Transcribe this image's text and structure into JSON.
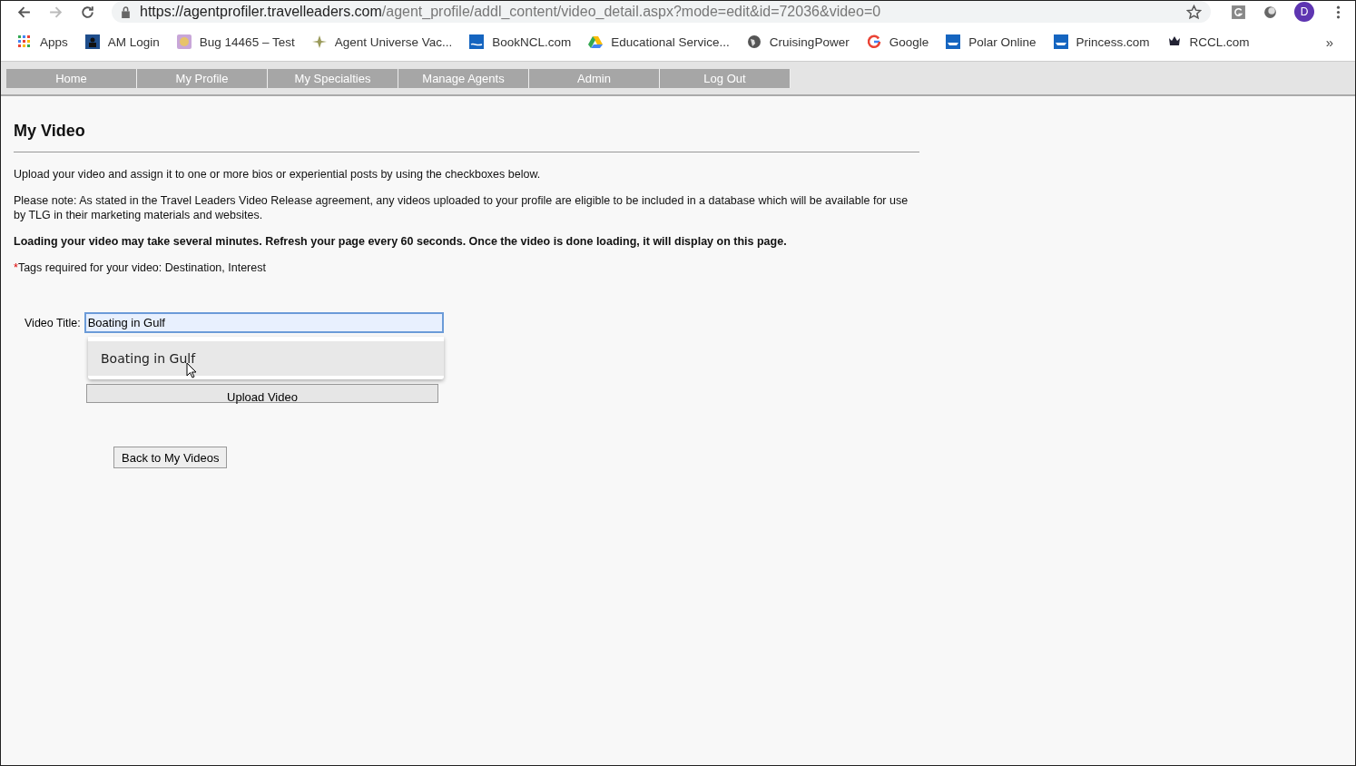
{
  "browser": {
    "url_host": "https://agentprofiler.travelleaders.com",
    "url_path": "/agent_profile/addl_content/video_detail.aspx?mode=edit&id=72036&video=0",
    "profile_initial": "D",
    "bookmarks": [
      {
        "label": "Apps",
        "kind": "grid"
      },
      {
        "label": "AM Login",
        "kind": "navy"
      },
      {
        "label": "Bug 14465 – Test",
        "kind": "bug"
      },
      {
        "label": "Agent Universe Vac...",
        "kind": "star"
      },
      {
        "label": "BookNCL.com",
        "kind": "ncl"
      },
      {
        "label": "Educational Service...",
        "kind": "drive"
      },
      {
        "label": "CruisingPower",
        "kind": "globe"
      },
      {
        "label": "Google",
        "kind": "google"
      },
      {
        "label": "Polar Online",
        "kind": "ship"
      },
      {
        "label": "Princess.com",
        "kind": "ship"
      },
      {
        "label": "RCCL.com",
        "kind": "crown"
      }
    ],
    "more": "»"
  },
  "nav": [
    {
      "label": "Home"
    },
    {
      "label": "My Profile"
    },
    {
      "label": "My Specialties"
    },
    {
      "label": "Manage Agents"
    },
    {
      "label": "Admin"
    },
    {
      "label": "Log Out"
    }
  ],
  "page": {
    "title": "My Video",
    "intro": "Upload your video and assign it to one or more bios or experiential posts by using the checkboxes below.",
    "note": "Please note: As stated in the Travel Leaders Video Release agreement, any videos uploaded to your profile are eligible to be included in a database which will be available for use by TLG in their marketing materials and websites.",
    "warning": "Loading your video may take several minutes. Refresh your page every 60 seconds. Once the video is done loading, it will display on this page.",
    "required_mark": "*",
    "tags_note": "Tags required for your video: Destination, Interest",
    "title_label": "Video Title:",
    "title_value": "Boating in Gulf",
    "suggestion": "Boating in Gulf",
    "upload_button": "Upload Video",
    "back_button": "Back to My Videos"
  }
}
